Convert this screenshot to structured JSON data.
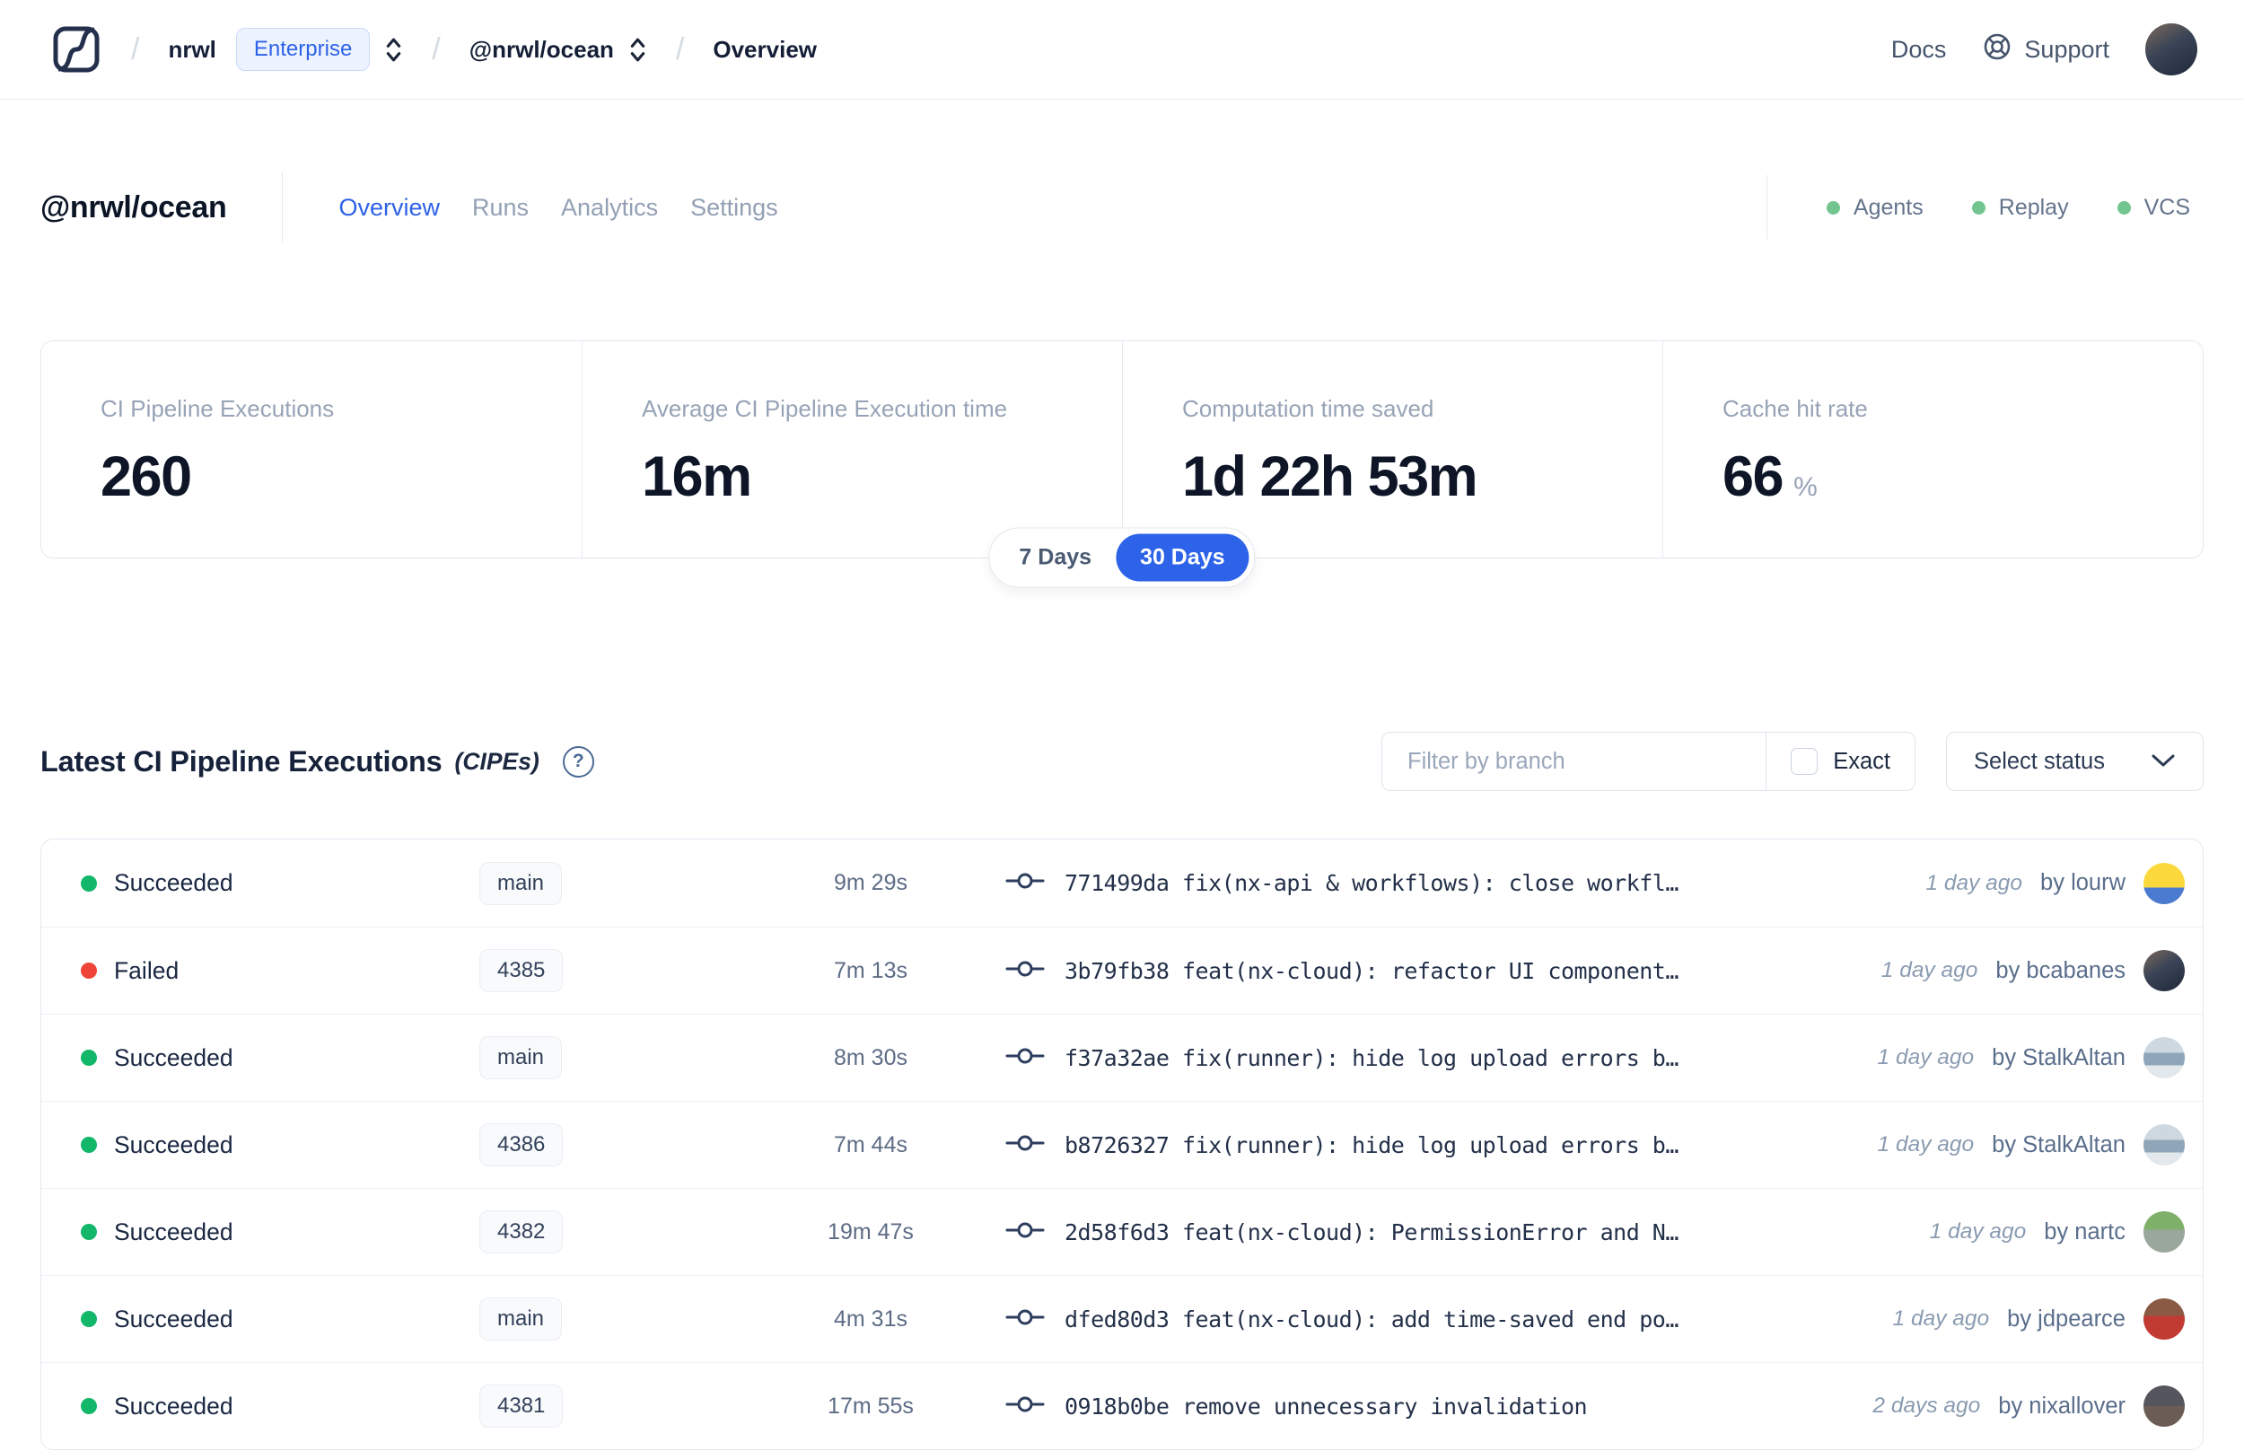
{
  "nav": {
    "breadcrumb": {
      "separator": "/",
      "org": "nrwl",
      "badge": "Enterprise",
      "workspace": "@nrwl/ocean",
      "page": "Overview"
    },
    "docs_label": "Docs",
    "support_label": "Support",
    "icons": {
      "logo": "nx-cloud-logo",
      "selector": "chevron-up-down",
      "support": "lifebuoy"
    }
  },
  "workspace": {
    "title": "@nrwl/ocean",
    "tabs": [
      {
        "label": "Overview",
        "active": true
      },
      {
        "label": "Runs",
        "active": false
      },
      {
        "label": "Analytics",
        "active": false
      },
      {
        "label": "Settings",
        "active": false
      }
    ],
    "services": [
      {
        "label": "Agents",
        "status_color": "#72c58f"
      },
      {
        "label": "Replay",
        "status_color": "#72c58f"
      },
      {
        "label": "VCS",
        "status_color": "#72c58f"
      }
    ]
  },
  "stats": {
    "cards": [
      {
        "label": "CI Pipeline Executions",
        "value": "260",
        "suffix": ""
      },
      {
        "label": "Average CI Pipeline Execution time",
        "value": "16m",
        "suffix": ""
      },
      {
        "label": "Computation time saved",
        "value": "1d 22h 53m",
        "suffix": ""
      },
      {
        "label": "Cache hit rate",
        "value": "66",
        "suffix": "%"
      }
    ],
    "range_toggle": {
      "options": [
        "7 Days",
        "30 Days"
      ],
      "selected": "30 Days",
      "active_color": "#2d63e9"
    }
  },
  "section": {
    "title": "Latest CI Pipeline Executions",
    "subtitle": "(CIPEs)",
    "help_glyph": "?",
    "filter_placeholder": "Filter by branch",
    "exact_label": "Exact",
    "exact_checked": false,
    "status_dropdown_label": "Select status"
  },
  "table": {
    "rows": [
      {
        "status": "Succeeded",
        "status_color": "#12b76a",
        "branch": "main",
        "duration": "9m 29s",
        "commit": "771499da fix(nx-api & workflows): close workfl…",
        "time_ago": "1 day ago",
        "author": "by lourw"
      },
      {
        "status": "Failed",
        "status_color": "#f04438",
        "branch": "4385",
        "duration": "7m 13s",
        "commit": "3b79fb38 feat(nx-cloud): refactor UI component…",
        "time_ago": "1 day ago",
        "author": "by bcabanes"
      },
      {
        "status": "Succeeded",
        "status_color": "#12b76a",
        "branch": "main",
        "duration": "8m 30s",
        "commit": "f37a32ae fix(runner): hide log upload errors b…",
        "time_ago": "1 day ago",
        "author": "by StalkAltan"
      },
      {
        "status": "Succeeded",
        "status_color": "#12b76a",
        "branch": "4386",
        "duration": "7m 44s",
        "commit": "b8726327 fix(runner): hide log upload errors b…",
        "time_ago": "1 day ago",
        "author": "by StalkAltan"
      },
      {
        "status": "Succeeded",
        "status_color": "#12b76a",
        "branch": "4382",
        "duration": "19m 47s",
        "commit": "2d58f6d3 feat(nx-cloud): PermissionError and N…",
        "time_ago": "1 day ago",
        "author": "by nartc"
      },
      {
        "status": "Succeeded",
        "status_color": "#12b76a",
        "branch": "main",
        "duration": "4m 31s",
        "commit": "dfed80d3 feat(nx-cloud): add time-saved end po…",
        "time_ago": "1 day ago",
        "author": "by jdpearce"
      },
      {
        "status": "Succeeded",
        "status_color": "#12b76a",
        "branch": "4381",
        "duration": "17m 55s",
        "commit": "0918b0be remove unnecessary invalidation",
        "time_ago": "2 days ago",
        "author": "by nixallover"
      }
    ]
  }
}
